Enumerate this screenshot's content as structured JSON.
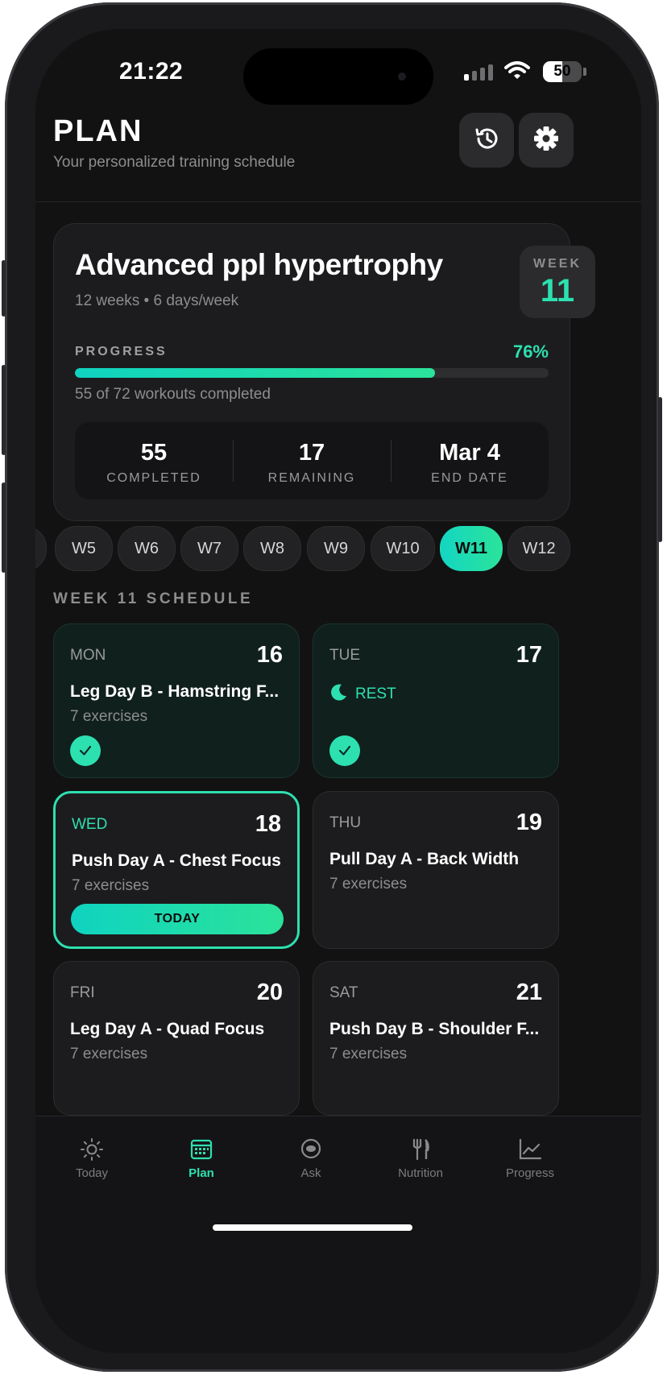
{
  "status_bar": {
    "time": "21:22",
    "battery": "50",
    "battery_level": 0.5
  },
  "header": {
    "title": "PLAN",
    "subtitle": "Your personalized training schedule",
    "history_icon": "history-icon",
    "settings_icon": "gear-icon"
  },
  "plan": {
    "name": "Advanced ppl hypertrophy",
    "meta": "12 weeks • 6 days/week",
    "week_label": "WEEK",
    "week_number": "11",
    "progress_label": "PROGRESS",
    "progress_percent": "76%",
    "progress_value": 0.76,
    "progress_note": "55 of 72 workouts completed",
    "stats": [
      {
        "value": "55",
        "label": "COMPLETED"
      },
      {
        "value": "17",
        "label": "REMAINING"
      },
      {
        "value": "Mar 4",
        "label": "END DATE"
      }
    ]
  },
  "weeks": [
    "W5",
    "W6",
    "W7",
    "W8",
    "W9",
    "W10",
    "W11",
    "W12"
  ],
  "active_week": "W11",
  "schedule": {
    "label": "WEEK 11 SCHEDULE",
    "days": [
      {
        "day": "MON",
        "date": "16",
        "workout": "Leg Day B - Hamstring F...",
        "exercises": "7 exercises",
        "status": "done"
      },
      {
        "day": "TUE",
        "date": "17",
        "rest_label": "REST",
        "status": "done"
      },
      {
        "day": "WED",
        "date": "18",
        "workout": "Push Day A - Chest Focus",
        "exercises": "7 exercises",
        "status": "today",
        "today_label": "TODAY"
      },
      {
        "day": "THU",
        "date": "19",
        "workout": "Pull Day A - Back Width",
        "exercises": "7 exercises",
        "status": "upcoming"
      },
      {
        "day": "FRI",
        "date": "20",
        "workout": "Leg Day A - Quad Focus",
        "exercises": "7 exercises",
        "status": "upcoming"
      },
      {
        "day": "SAT",
        "date": "21",
        "workout": "Push Day B - Shoulder F...",
        "exercises": "7 exercises",
        "status": "upcoming"
      }
    ]
  },
  "tabs": [
    {
      "label": "Today",
      "icon": "sun-icon"
    },
    {
      "label": "Plan",
      "icon": "calendar-icon",
      "active": true
    },
    {
      "label": "Ask",
      "icon": "chat-icon"
    },
    {
      "label": "Nutrition",
      "icon": "utensils-icon"
    },
    {
      "label": "Progress",
      "icon": "chart-icon"
    }
  ],
  "colors": {
    "accent": "#2de0b0",
    "background": "#121212",
    "card": "#1c1c1e"
  }
}
